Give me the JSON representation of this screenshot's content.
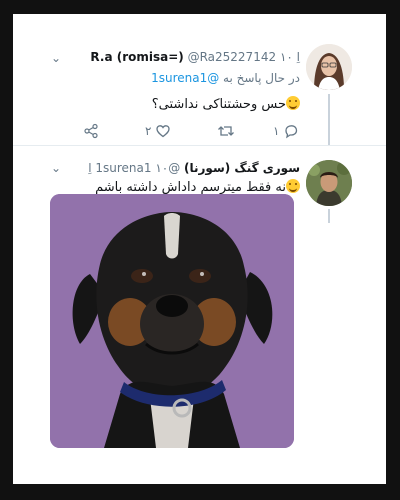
{
  "tweet1": {
    "name": "R.a (romisa=)",
    "handle": "@Ra25227142",
    "time": "۱۰ اِ",
    "reply_prefix": "در حال پاسخ به",
    "reply_mention": "@1surena1",
    "text": "حس وحشتناکی نداشتی؟",
    "actions": {
      "reply_count": "۱",
      "retweet_count": "",
      "like_count": "۲"
    }
  },
  "tweet2": {
    "name": "سوری گنگ (سورنا)",
    "handle": "@1surena1",
    "time": "۱۰ اِ",
    "text": "نه فقط میترسم داداش داشته باشم"
  },
  "icons": {
    "chevron": "chevron-down-icon",
    "reply": "reply-icon",
    "retweet": "retweet-icon",
    "like": "heart-icon",
    "share": "share-icon"
  },
  "colors": {
    "accent": "#1b95e0",
    "muted": "#657786",
    "text": "#14171a",
    "photo_bg": "#8f6fa8"
  }
}
